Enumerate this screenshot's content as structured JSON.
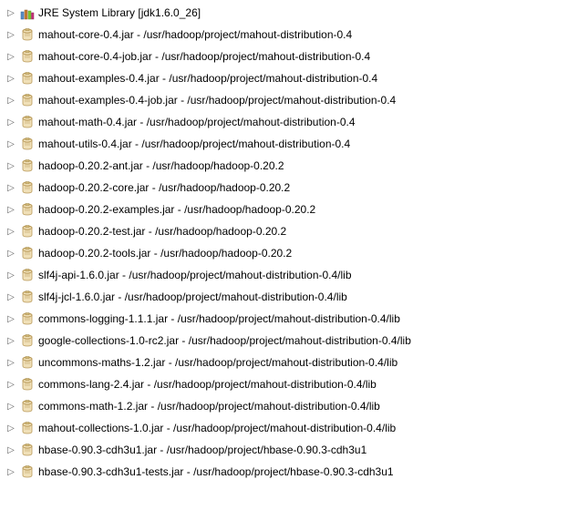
{
  "tree": {
    "items": [
      {
        "icon": "library",
        "label": "JRE System Library [jdk1.6.0_26]"
      },
      {
        "icon": "jar",
        "label": "mahout-core-0.4.jar - /usr/hadoop/project/mahout-distribution-0.4"
      },
      {
        "icon": "jar",
        "label": "mahout-core-0.4-job.jar - /usr/hadoop/project/mahout-distribution-0.4"
      },
      {
        "icon": "jar",
        "label": "mahout-examples-0.4.jar - /usr/hadoop/project/mahout-distribution-0.4"
      },
      {
        "icon": "jar",
        "label": "mahout-examples-0.4-job.jar - /usr/hadoop/project/mahout-distribution-0.4"
      },
      {
        "icon": "jar",
        "label": "mahout-math-0.4.jar - /usr/hadoop/project/mahout-distribution-0.4"
      },
      {
        "icon": "jar",
        "label": "mahout-utils-0.4.jar - /usr/hadoop/project/mahout-distribution-0.4"
      },
      {
        "icon": "jar",
        "label": "hadoop-0.20.2-ant.jar - /usr/hadoop/hadoop-0.20.2"
      },
      {
        "icon": "jar",
        "label": "hadoop-0.20.2-core.jar - /usr/hadoop/hadoop-0.20.2"
      },
      {
        "icon": "jar",
        "label": "hadoop-0.20.2-examples.jar - /usr/hadoop/hadoop-0.20.2"
      },
      {
        "icon": "jar",
        "label": "hadoop-0.20.2-test.jar - /usr/hadoop/hadoop-0.20.2"
      },
      {
        "icon": "jar",
        "label": "hadoop-0.20.2-tools.jar - /usr/hadoop/hadoop-0.20.2"
      },
      {
        "icon": "jar",
        "label": "slf4j-api-1.6.0.jar - /usr/hadoop/project/mahout-distribution-0.4/lib"
      },
      {
        "icon": "jar",
        "label": "slf4j-jcl-1.6.0.jar - /usr/hadoop/project/mahout-distribution-0.4/lib"
      },
      {
        "icon": "jar",
        "label": "commons-logging-1.1.1.jar - /usr/hadoop/project/mahout-distribution-0.4/lib"
      },
      {
        "icon": "jar",
        "label": "google-collections-1.0-rc2.jar - /usr/hadoop/project/mahout-distribution-0.4/lib"
      },
      {
        "icon": "jar",
        "label": "uncommons-maths-1.2.jar - /usr/hadoop/project/mahout-distribution-0.4/lib"
      },
      {
        "icon": "jar",
        "label": "commons-lang-2.4.jar - /usr/hadoop/project/mahout-distribution-0.4/lib"
      },
      {
        "icon": "jar",
        "label": "commons-math-1.2.jar - /usr/hadoop/project/mahout-distribution-0.4/lib"
      },
      {
        "icon": "jar",
        "label": "mahout-collections-1.0.jar - /usr/hadoop/project/mahout-distribution-0.4/lib"
      },
      {
        "icon": "jar",
        "label": "hbase-0.90.3-cdh3u1.jar - /usr/hadoop/project/hbase-0.90.3-cdh3u1"
      },
      {
        "icon": "jar",
        "label": "hbase-0.90.3-cdh3u1-tests.jar - /usr/hadoop/project/hbase-0.90.3-cdh3u1"
      }
    ]
  }
}
